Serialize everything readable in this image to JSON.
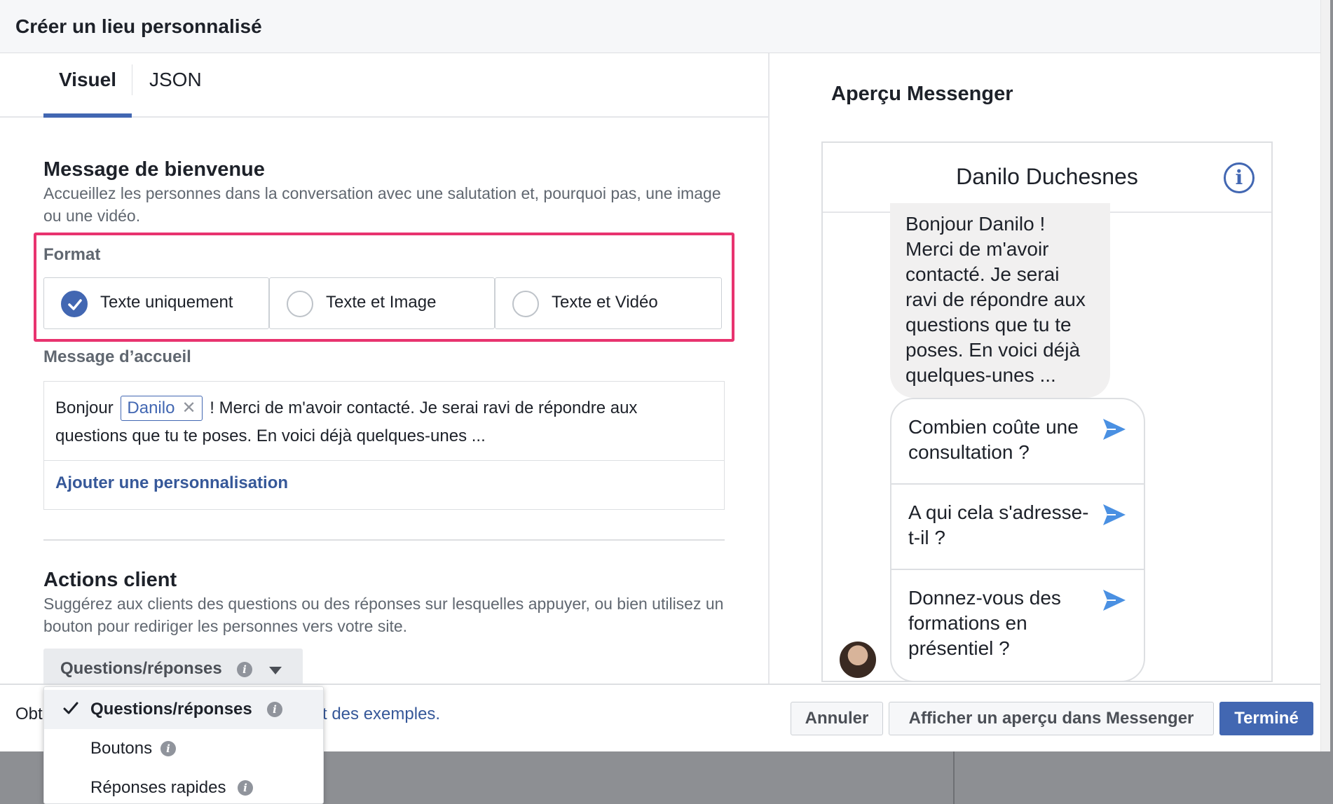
{
  "dialog": {
    "title": "Créer un lieu personnalisé"
  },
  "tabs": [
    {
      "label": "Visuel",
      "active": true
    },
    {
      "label": "JSON",
      "active": false
    }
  ],
  "welcome": {
    "title": "Message de bienvenue",
    "description": "Accueillez les personnes dans la conversation avec une salutation et, pourquoi pas, une image ou une vidéo.",
    "format_label": "Format",
    "format_options": [
      {
        "label": "Texte uniquement",
        "checked": true
      },
      {
        "label": "Texte et Image",
        "checked": false
      },
      {
        "label": "Texte et Vidéo",
        "checked": false
      }
    ],
    "greeting_label": "Message d’accueil",
    "greeting_prefix": "Bonjour",
    "greeting_token": "Danilo",
    "greeting_suffix": "! Merci de m'avoir contacté. Je serai ravi de répondre aux questions que tu te poses. En voici déjà quelques-unes ...",
    "add_personalization": "Ajouter une personnalisation"
  },
  "actions": {
    "title": "Actions client",
    "description": "Suggérez aux clients des questions ou des réponses sur lesquelles appuyer, ou bien utilisez un bouton pour rediriger les personnes vers votre site.",
    "select_value": "Questions/réponses",
    "options": [
      {
        "label": "Questions/réponses",
        "selected": true,
        "info": true
      },
      {
        "label": "Boutons",
        "selected": false,
        "info": true
      },
      {
        "label": "Réponses rapides",
        "selected": false,
        "info": true
      }
    ]
  },
  "preview": {
    "title": "Aperçu Messenger",
    "contact_name": "Danilo Duchesnes",
    "bubble": "Bonjour Danilo ! Merci de m'avoir contacté. Je serai ravi de répondre aux questions que tu te poses. En voici déjà quelques-unes ...",
    "questions": [
      "Combien coûte une consultation ?",
      "A qui cela s'adresse-t-il ?",
      "Donnez-vous des formations en présentiel ?"
    ]
  },
  "footer": {
    "text_visible": "Obt",
    "link_visible": "t des exemples.",
    "cancel": "Annuler",
    "preview_button": "Afficher un aperçu dans Messenger",
    "done": "Terminé"
  },
  "colors": {
    "accent": "#4267b2",
    "highlight": "#e8336f",
    "link": "#365899"
  }
}
